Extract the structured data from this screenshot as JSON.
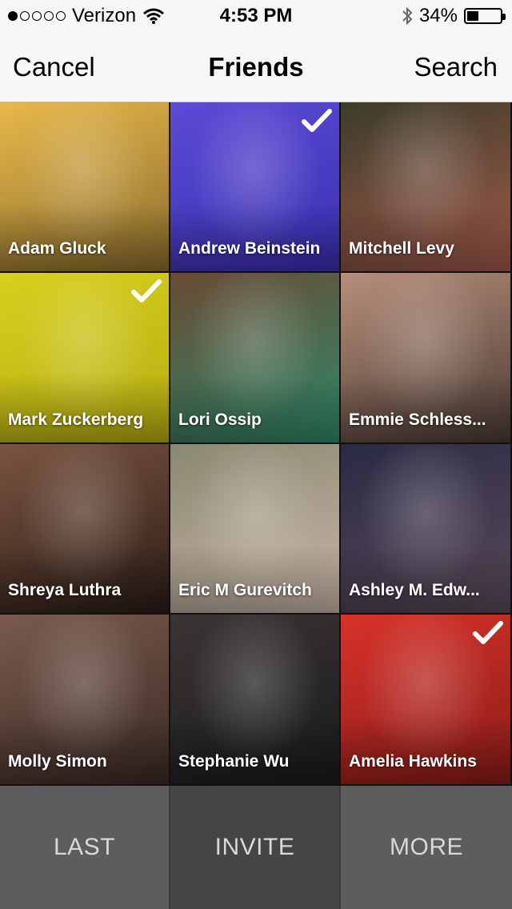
{
  "status_bar": {
    "carrier": "Verizon",
    "time": "4:53 PM",
    "battery": "34%",
    "battery_level": 0.34,
    "signal_dots_filled": 1,
    "icons": [
      "wifi-icon",
      "bluetooth-icon",
      "battery-icon"
    ]
  },
  "nav": {
    "left": "Cancel",
    "title": "Friends",
    "right": "Search"
  },
  "friends": [
    {
      "name": "Adam Gluck",
      "selected": false,
      "tint": "#e8b84a",
      "tint2": "#8a6d2c"
    },
    {
      "name": "Andrew Beinstein",
      "selected": true,
      "tint": "#5b4bd6",
      "tint2": "#3a2fb0"
    },
    {
      "name": "Mitchell Levy",
      "selected": false,
      "tint": "#3b3c2a",
      "tint2": "#a25a4a"
    },
    {
      "name": "Mark Zuckerberg",
      "selected": true,
      "tint": "#d8d01e",
      "tint2": "#b5ad10"
    },
    {
      "name": "Lori Ossip",
      "selected": false,
      "tint": "#6a4a34",
      "tint2": "#2f8a6a"
    },
    {
      "name": "Emmie Schless...",
      "selected": false,
      "tint": "#b78f7a",
      "tint2": "#4a3a34"
    },
    {
      "name": "Shreya Luthra",
      "selected": false,
      "tint": "#7a5440",
      "tint2": "#2b1c16"
    },
    {
      "name": "Eric M Gurevitch",
      "selected": false,
      "tint": "#8a8870",
      "tint2": "#c9b5a8"
    },
    {
      "name": "Ashley M. Edw...",
      "selected": false,
      "tint": "#2a2a44",
      "tint2": "#5a4a5a"
    },
    {
      "name": "Molly Simon",
      "selected": false,
      "tint": "#7a5a4e",
      "tint2": "#3a2a24"
    },
    {
      "name": "Stephanie Wu",
      "selected": false,
      "tint": "#3a3438",
      "tint2": "#1a1a1a"
    },
    {
      "name": "Amelia Hawkins",
      "selected": true,
      "tint": "#d8322a",
      "tint2": "#8a1c18"
    }
  ],
  "bottom": {
    "last": "LAST",
    "invite": "INVITE",
    "more": "MORE"
  }
}
